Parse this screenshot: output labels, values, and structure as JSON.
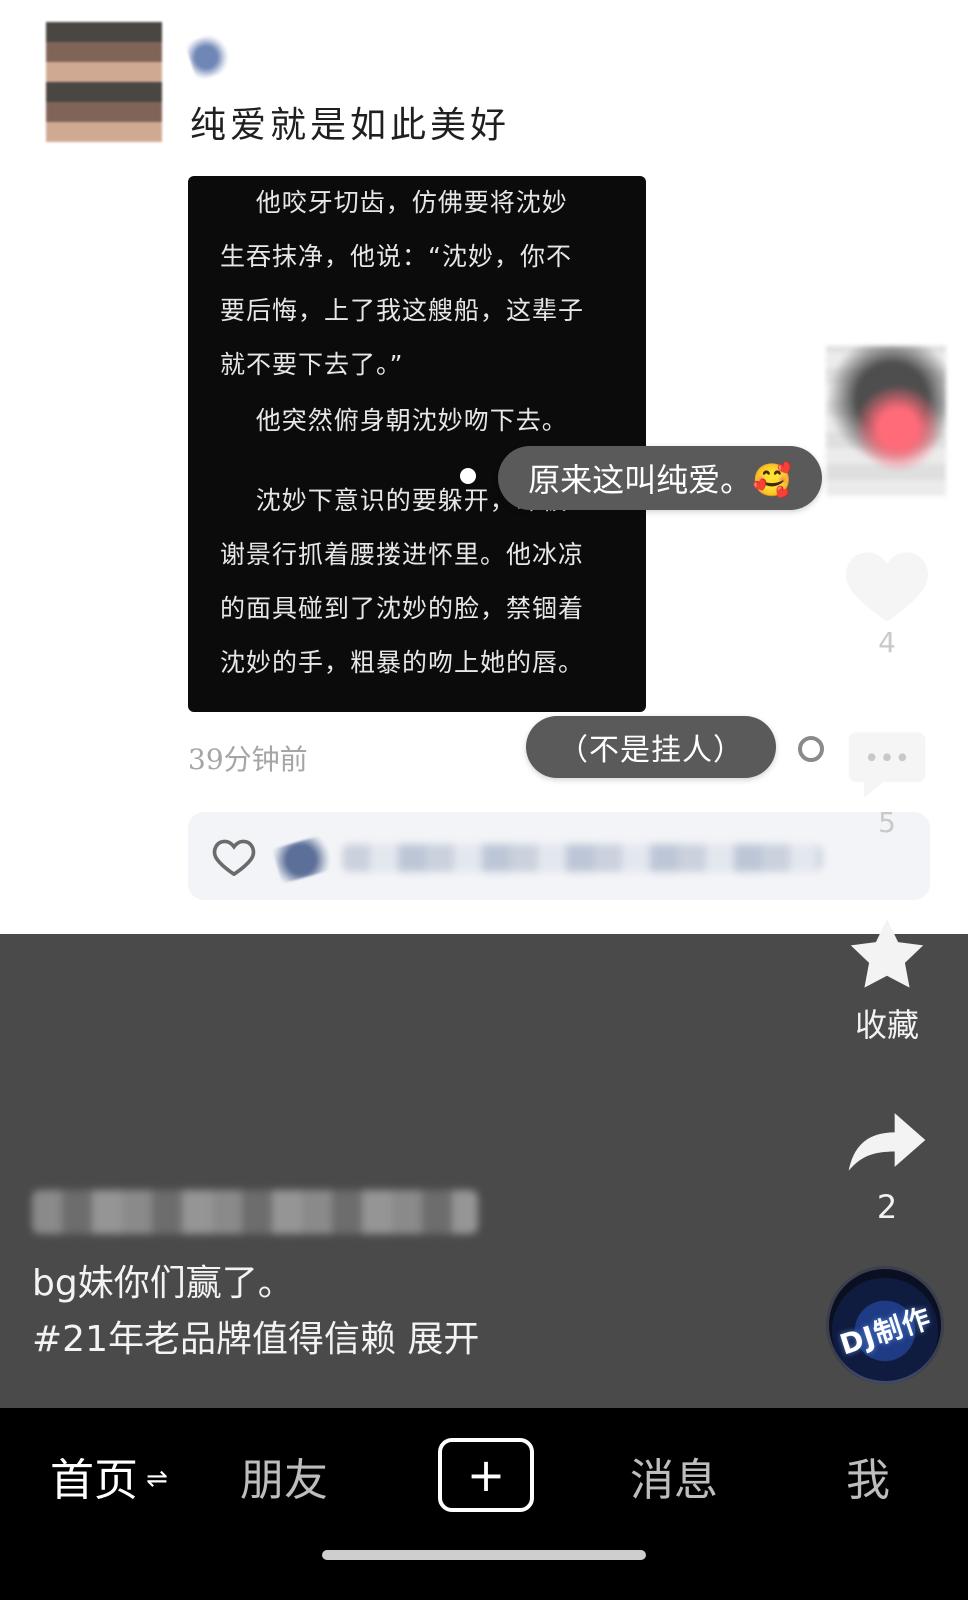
{
  "post": {
    "title": "纯爱就是如此美好",
    "time": "39分钟前",
    "image_text": {
      "p1": "    他咬牙切齿，仿佛要将沈妙\n生吞抹净，他说：“沈妙，你不\n要后悔，上了我这艘船，这辈子\n就不要下去了。”",
      "p2": "    他突然俯身朝沈妙吻下去。",
      "p3": "    沈妙下意识的要躲开，却被\n谢景行抓着腰搂进怀里。他冰凉\n的面具碰到了沈妙的脸，禁锢着\n沈妙的手，粗暴的吻上她的唇。"
    }
  },
  "overlays": {
    "bubble1": "原来这叫纯爱。🥰",
    "bubble2": "（不是挂人）"
  },
  "rail": {
    "like_count": "4",
    "comment_count": "5",
    "favorite_label": "收藏",
    "share_count": "2"
  },
  "caption": {
    "line1": "bg妹你们赢了。",
    "line2": "#21年老品牌值得信赖 展开"
  },
  "music": {
    "disc_text": "DJ制作"
  },
  "bottom_nav": {
    "home": "首页",
    "home_swap": "⇌",
    "friends": "朋友",
    "messages": "消息",
    "me": "我",
    "plus": "+"
  },
  "colors": {
    "background_dark": "#4a4a4a",
    "nav_black": "#000000",
    "bubble": "#5a5a5a",
    "card_black": "#0b0b0b"
  }
}
